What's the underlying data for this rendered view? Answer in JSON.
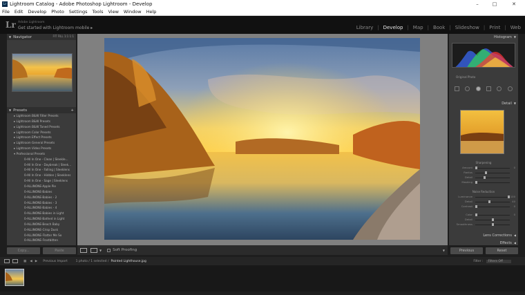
{
  "window": {
    "title": "Lightroom Catalog - Adobe Photoshop Lightroom - Develop",
    "controls": [
      "–",
      "□",
      "✕"
    ]
  },
  "menu": [
    "File",
    "Edit",
    "Develop",
    "Photo",
    "Settings",
    "Tools",
    "View",
    "Window",
    "Help"
  ],
  "identity": {
    "logo": "Lr",
    "line1": "Adobe Lightroom",
    "line2": "Get started with Lightroom mobile ▸"
  },
  "modules": [
    "Library",
    "Develop",
    "Map",
    "Book",
    "Slideshow",
    "Print",
    "Web"
  ],
  "active_module": "Develop",
  "left": {
    "navigator": "Navigator",
    "zoom": "FIT  FILL  1:1  1:1",
    "presets_title": "Presets",
    "presets": [
      "Lightroom B&W Filter Presets",
      "Lightroom B&W Presets",
      "Lightroom B&W Toned Presets",
      "Lightroom Color Presets",
      "Lightroom Effect Presets",
      "Lightroom General Presets",
      "Lightroom Video Presets",
      "Professional Presets"
    ],
    "subpresets": [
      "0-All In One - Clean | Sleekle...",
      "0-All In One - Daybreak | Sleek...",
      "0-All In One - Falling | Sleeklens",
      "0-All In One - Hidden | Sleeklens",
      "0-All In One - Sage | Sleeklens",
      "0-ALLINONE-Apple Pie",
      "0-ALLINONE-Babies",
      "0-ALLINONE-Babies - 2",
      "0-ALLINONE-Babies - 3",
      "0-ALLINONE-Babies - 4",
      "0-ALLINONE-Babies in Light",
      "0-ALLINONE-Bathed in Light",
      "0-ALLINONE-Beach Baby",
      "0-ALLINONE-Crisp Dusk",
      "0-ALLINONE-Flatter Me So",
      "0-ALLINONE-Frostbitten"
    ],
    "copy": "Copy...",
    "paste": "Paste"
  },
  "toolbar": {
    "soft_proofing": "Soft Proofing"
  },
  "right": {
    "histogram": "Histogram",
    "original_photo": "Original Photo",
    "detail": "Detail",
    "sharpening": "Sharpening",
    "noise_reduction": "Noise Reduction",
    "sliders": [
      {
        "label": "Amount",
        "value": "0",
        "level": 0.0
      },
      {
        "label": "Radius",
        "value": "",
        "level": 0.3
      },
      {
        "label": "Detail",
        "value": "",
        "level": 0.25
      },
      {
        "label": "Masking",
        "value": "",
        "level": 0.0
      },
      {
        "label": "Luminance",
        "value": "100",
        "level": 1.0
      },
      {
        "label": "Detail",
        "value": "40",
        "level": 0.4
      },
      {
        "label": "Contrast",
        "value": "0",
        "level": 0.0
      },
      {
        "label": "Color",
        "value": "0",
        "level": 0.0
      },
      {
        "label": "Detail",
        "value": "",
        "level": 0.5
      },
      {
        "label": "Smoothness",
        "value": "",
        "level": 0.5
      }
    ],
    "lens_corrections": "Lens Corrections",
    "effects": "Effects",
    "previous": "Previous",
    "reset": "Reset"
  },
  "filmstrip": {
    "source": "Previous Import",
    "count": "1 photo / 1 selected /",
    "filename": "Painted Lighthouse.jpg",
    "filter_label": "Filter :",
    "filter_value": "Filters Off"
  }
}
